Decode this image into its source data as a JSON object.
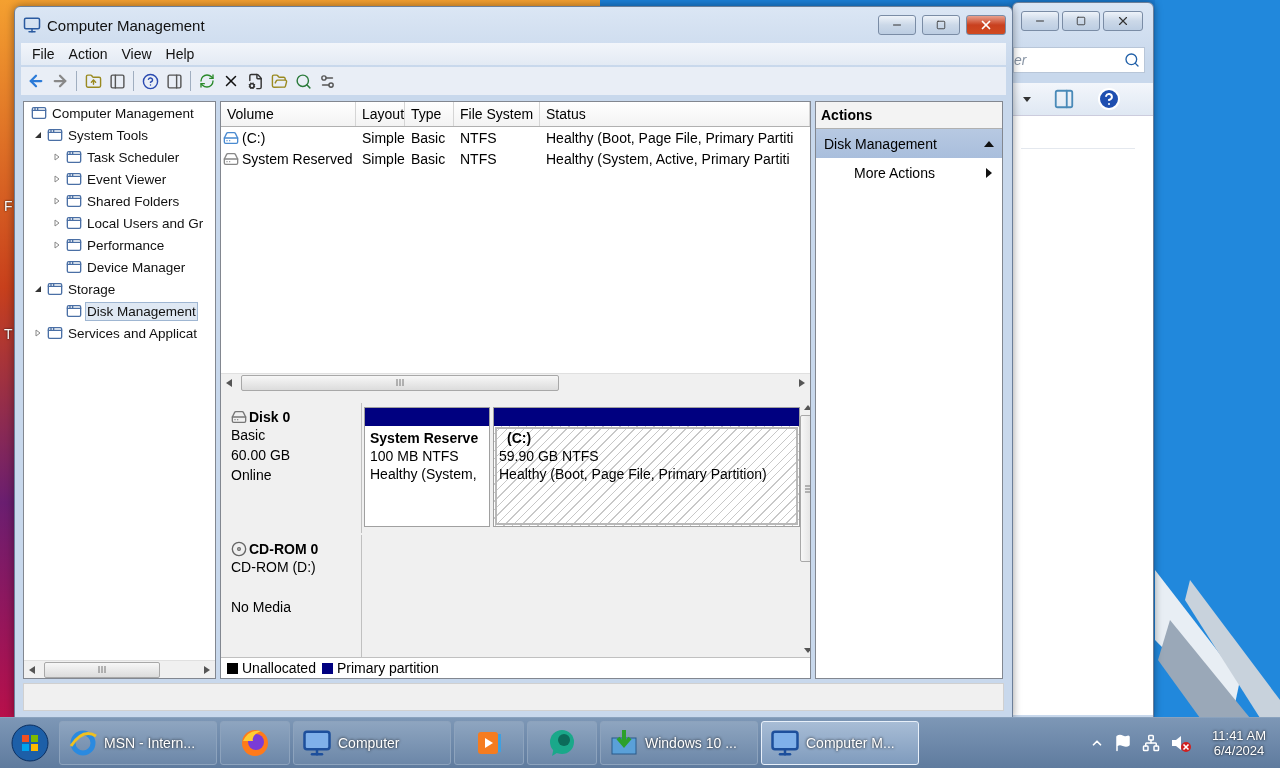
{
  "desktop": {
    "labels": [
      "F",
      "T"
    ]
  },
  "background_window": {
    "search": {
      "placeholder": "er"
    }
  },
  "window": {
    "title": "Computer Management"
  },
  "menu": [
    "File",
    "Action",
    "View",
    "Help"
  ],
  "tree": [
    {
      "label": "Computer Management",
      "selected": false,
      "children": [
        {
          "label": "System Tools",
          "expanded": true,
          "selected": false,
          "children": [
            {
              "label": "Task Scheduler",
              "expanded": false,
              "selected": false
            },
            {
              "label": "Event Viewer",
              "expanded": false,
              "selected": false
            },
            {
              "label": "Shared Folders",
              "expanded": false,
              "selected": false
            },
            {
              "label": "Local Users and Gr",
              "expanded": false,
              "selected": false
            },
            {
              "label": "Performance",
              "expanded": false,
              "selected": false
            },
            {
              "label": "Device Manager",
              "selected": false
            }
          ]
        },
        {
          "label": "Storage",
          "expanded": true,
          "selected": false,
          "children": [
            {
              "label": "Disk Management",
              "selected": true
            }
          ]
        },
        {
          "label": "Services and Applicat",
          "expanded": false,
          "selected": false
        }
      ]
    }
  ],
  "volumes": {
    "columns": [
      "Volume",
      "Layout",
      "Type",
      "File System",
      "Status"
    ],
    "rows": [
      {
        "volume": "(C:)",
        "layout": "Simple",
        "type": "Basic",
        "file_system": "NTFS",
        "status": "Healthy (Boot, Page File, Primary Partiti"
      },
      {
        "volume": "System Reserved",
        "layout": "Simple",
        "type": "Basic",
        "file_system": "NTFS",
        "status": "Healthy (System, Active, Primary Partiti"
      }
    ]
  },
  "disks": [
    {
      "name": "Disk 0",
      "kind": "disk",
      "type": "Basic",
      "size": "60.00 GB",
      "status": "Online",
      "partitions": [
        {
          "name": "System Reserve",
          "size": "100 MB NTFS",
          "status": "Healthy (System,",
          "selected": false,
          "color": "#000080"
        },
        {
          "name": "(C:)",
          "size": "59.90 GB NTFS",
          "status": "Healthy (Boot, Page File, Primary Partition)",
          "selected": true,
          "color": "#000080"
        }
      ]
    },
    {
      "name": "CD-ROM 0",
      "kind": "cdrom",
      "type": "CD-ROM (D:)",
      "status": "No Media"
    }
  ],
  "legend": [
    {
      "label": "Unallocated",
      "color": "#000000"
    },
    {
      "label": "Primary partition",
      "color": "#000080"
    }
  ],
  "actions": {
    "title": "Actions",
    "sections": [
      {
        "label": "Disk Management",
        "expanded": true,
        "items": [
          {
            "label": "More Actions"
          }
        ]
      }
    ]
  },
  "taskbar": {
    "items": [
      {
        "kind": "ie",
        "label": "MSN - Intern...",
        "selected": false
      },
      {
        "kind": "firefox",
        "selected": false
      },
      {
        "kind": "explorer",
        "label": "Computer",
        "selected": false
      },
      {
        "kind": "media",
        "selected": false
      },
      {
        "kind": "chat",
        "selected": false
      },
      {
        "kind": "installer",
        "label": "Windows 10 ...",
        "selected": false
      },
      {
        "kind": "console",
        "label": "Computer M...",
        "selected": true
      }
    ],
    "volume_muted": true,
    "time": "11:41 AM",
    "date": "6/4/2024"
  }
}
